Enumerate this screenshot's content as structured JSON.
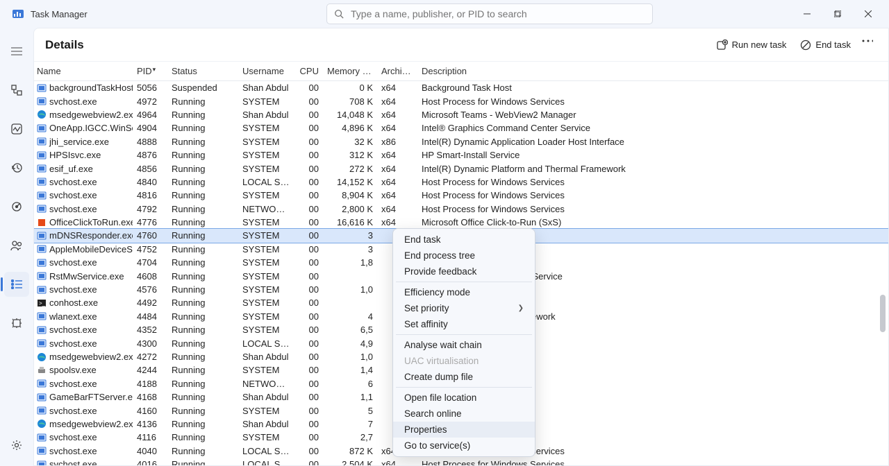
{
  "app": {
    "title": "Task Manager"
  },
  "search": {
    "placeholder": "Type a name, publisher, or PID to search"
  },
  "header": {
    "title": "Details",
    "run_new_task": "Run new task",
    "end_task": "End task"
  },
  "columns": {
    "name": "Name",
    "pid": "PID",
    "status": "Status",
    "user": "Username",
    "cpu": "CPU",
    "mem": "Memory (ac...",
    "arch": "Architec...",
    "desc": "Description"
  },
  "context_menu": {
    "end_task": "End task",
    "end_tree": "End process tree",
    "feedback": "Provide feedback",
    "efficiency": "Efficiency mode",
    "priority": "Set priority",
    "affinity": "Set affinity",
    "analyse": "Analyse wait chain",
    "uac": "UAC virtualisation",
    "dump": "Create dump file",
    "open_loc": "Open file location",
    "search_online": "Search online",
    "properties": "Properties",
    "goto_service": "Go to service(s)"
  },
  "processes": [
    {
      "icon": "win",
      "name": "backgroundTaskHost....",
      "pid": "5056",
      "status": "Suspended",
      "user": "Shan Abdul",
      "cpu": "00",
      "mem": "0 K",
      "arch": "x64",
      "desc": "Background Task Host"
    },
    {
      "icon": "svc",
      "name": "svchost.exe",
      "pid": "4972",
      "status": "Running",
      "user": "SYSTEM",
      "cpu": "00",
      "mem": "708 K",
      "arch": "x64",
      "desc": "Host Process for Windows Services"
    },
    {
      "icon": "edge",
      "name": "msedgewebview2.exe",
      "pid": "4964",
      "status": "Running",
      "user": "Shan Abdul",
      "cpu": "00",
      "mem": "14,048 K",
      "arch": "x64",
      "desc": "Microsoft Teams - WebView2 Manager"
    },
    {
      "icon": "win",
      "name": "OneApp.IGCC.WinSer...",
      "pid": "4904",
      "status": "Running",
      "user": "SYSTEM",
      "cpu": "00",
      "mem": "4,896 K",
      "arch": "x64",
      "desc": "Intel® Graphics Command Center Service"
    },
    {
      "icon": "gen",
      "name": "jhi_service.exe",
      "pid": "4888",
      "status": "Running",
      "user": "SYSTEM",
      "cpu": "00",
      "mem": "32 K",
      "arch": "x86",
      "desc": "Intel(R) Dynamic Application Loader Host Interface"
    },
    {
      "icon": "win",
      "name": "HPSIsvc.exe",
      "pid": "4876",
      "status": "Running",
      "user": "SYSTEM",
      "cpu": "00",
      "mem": "312 K",
      "arch": "x64",
      "desc": "HP Smart-Install Service"
    },
    {
      "icon": "gen",
      "name": "esif_uf.exe",
      "pid": "4856",
      "status": "Running",
      "user": "SYSTEM",
      "cpu": "00",
      "mem": "272 K",
      "arch": "x64",
      "desc": "Intel(R) Dynamic Platform and Thermal Framework"
    },
    {
      "icon": "svc",
      "name": "svchost.exe",
      "pid": "4840",
      "status": "Running",
      "user": "LOCAL SER...",
      "cpu": "00",
      "mem": "14,152 K",
      "arch": "x64",
      "desc": "Host Process for Windows Services"
    },
    {
      "icon": "svc",
      "name": "svchost.exe",
      "pid": "4816",
      "status": "Running",
      "user": "SYSTEM",
      "cpu": "00",
      "mem": "8,904 K",
      "arch": "x64",
      "desc": "Host Process for Windows Services"
    },
    {
      "icon": "svc",
      "name": "svchost.exe",
      "pid": "4792",
      "status": "Running",
      "user": "NETWORK ...",
      "cpu": "00",
      "mem": "2,800 K",
      "arch": "x64",
      "desc": "Host Process for Windows Services"
    },
    {
      "icon": "office",
      "name": "OfficeClickToRun.exe",
      "pid": "4776",
      "status": "Running",
      "user": "SYSTEM",
      "cpu": "00",
      "mem": "16,616 K",
      "arch": "x64",
      "desc": "Microsoft Office Click-to-Run (SxS)"
    },
    {
      "icon": "win",
      "name": "mDNSResponder.exe",
      "pid": "4760",
      "status": "Running",
      "user": "SYSTEM",
      "cpu": "00",
      "mem": "3",
      "arch": "",
      "desc": "",
      "selected": true
    },
    {
      "icon": "win",
      "name": "AppleMobileDeviceS...",
      "pid": "4752",
      "status": "Running",
      "user": "SYSTEM",
      "cpu": "00",
      "mem": "3",
      "arch": "",
      "desc": ""
    },
    {
      "icon": "svc",
      "name": "svchost.exe",
      "pid": "4704",
      "status": "Running",
      "user": "SYSTEM",
      "cpu": "00",
      "mem": "1,8",
      "arch": "",
      "desc": "adows Services"
    },
    {
      "icon": "gen",
      "name": "RstMwService.exe",
      "pid": "4608",
      "status": "Running",
      "user": "SYSTEM",
      "cpu": "00",
      "mem": "",
      "arch": "",
      "desc": "e Technology Management Service"
    },
    {
      "icon": "svc",
      "name": "svchost.exe",
      "pid": "4576",
      "status": "Running",
      "user": "SYSTEM",
      "cpu": "00",
      "mem": "1,0",
      "arch": "",
      "desc": "adows Services"
    },
    {
      "icon": "con",
      "name": "conhost.exe",
      "pid": "4492",
      "status": "Running",
      "user": "SYSTEM",
      "cpu": "00",
      "mem": "",
      "arch": "",
      "desc": "st"
    },
    {
      "icon": "win",
      "name": "wlanext.exe",
      "pid": "4484",
      "status": "Running",
      "user": "SYSTEM",
      "cpu": "00",
      "mem": "4",
      "arch": "",
      "desc": "N 802.11 Extensibility Framework"
    },
    {
      "icon": "svc",
      "name": "svchost.exe",
      "pid": "4352",
      "status": "Running",
      "user": "SYSTEM",
      "cpu": "00",
      "mem": "6,5",
      "arch": "",
      "desc": "adows Services"
    },
    {
      "icon": "svc",
      "name": "svchost.exe",
      "pid": "4300",
      "status": "Running",
      "user": "LOCAL SER...",
      "cpu": "00",
      "mem": "4,9",
      "arch": "",
      "desc": "adows Services"
    },
    {
      "icon": "edge",
      "name": "msedgewebview2.exe",
      "pid": "4272",
      "status": "Running",
      "user": "Shan Abdul",
      "cpu": "00",
      "mem": "1,0",
      "arch": "",
      "desc": "Utility: Network Service"
    },
    {
      "icon": "spool",
      "name": "spoolsv.exe",
      "pid": "4244",
      "status": "Running",
      "user": "SYSTEM",
      "cpu": "00",
      "mem": "1,4",
      "arch": "",
      "desc": "app"
    },
    {
      "icon": "svc",
      "name": "svchost.exe",
      "pid": "4188",
      "status": "Running",
      "user": "NETWORK ...",
      "cpu": "00",
      "mem": "6",
      "arch": "",
      "desc": "adows Services"
    },
    {
      "icon": "win",
      "name": "GameBarFTServer.exe",
      "pid": "4168",
      "status": "Running",
      "user": "Shan Abdul",
      "cpu": "00",
      "mem": "1,1",
      "arch": "",
      "desc": "rust COM Server"
    },
    {
      "icon": "svc",
      "name": "svchost.exe",
      "pid": "4160",
      "status": "Running",
      "user": "SYSTEM",
      "cpu": "00",
      "mem": "5",
      "arch": "",
      "desc": "adows Services"
    },
    {
      "icon": "edge",
      "name": "msedgewebview2.exe",
      "pid": "4136",
      "status": "Running",
      "user": "Shan Abdul",
      "cpu": "00",
      "mem": "7",
      "arch": "",
      "desc": "Edge WebView2"
    },
    {
      "icon": "svc",
      "name": "svchost.exe",
      "pid": "4116",
      "status": "Running",
      "user": "SYSTEM",
      "cpu": "00",
      "mem": "2,7",
      "arch": "",
      "desc": "adows Services"
    },
    {
      "icon": "svc",
      "name": "svchost.exe",
      "pid": "4040",
      "status": "Running",
      "user": "LOCAL SER...",
      "cpu": "00",
      "mem": "872 K",
      "arch": "x64",
      "desc": "Host Process for Windows Services"
    },
    {
      "icon": "svc",
      "name": "svchost.exe",
      "pid": "4016",
      "status": "Running",
      "user": "LOCAL SER...",
      "cpu": "00",
      "mem": "2,504 K",
      "arch": "x64",
      "desc": "Host Process for Windows Services"
    }
  ]
}
